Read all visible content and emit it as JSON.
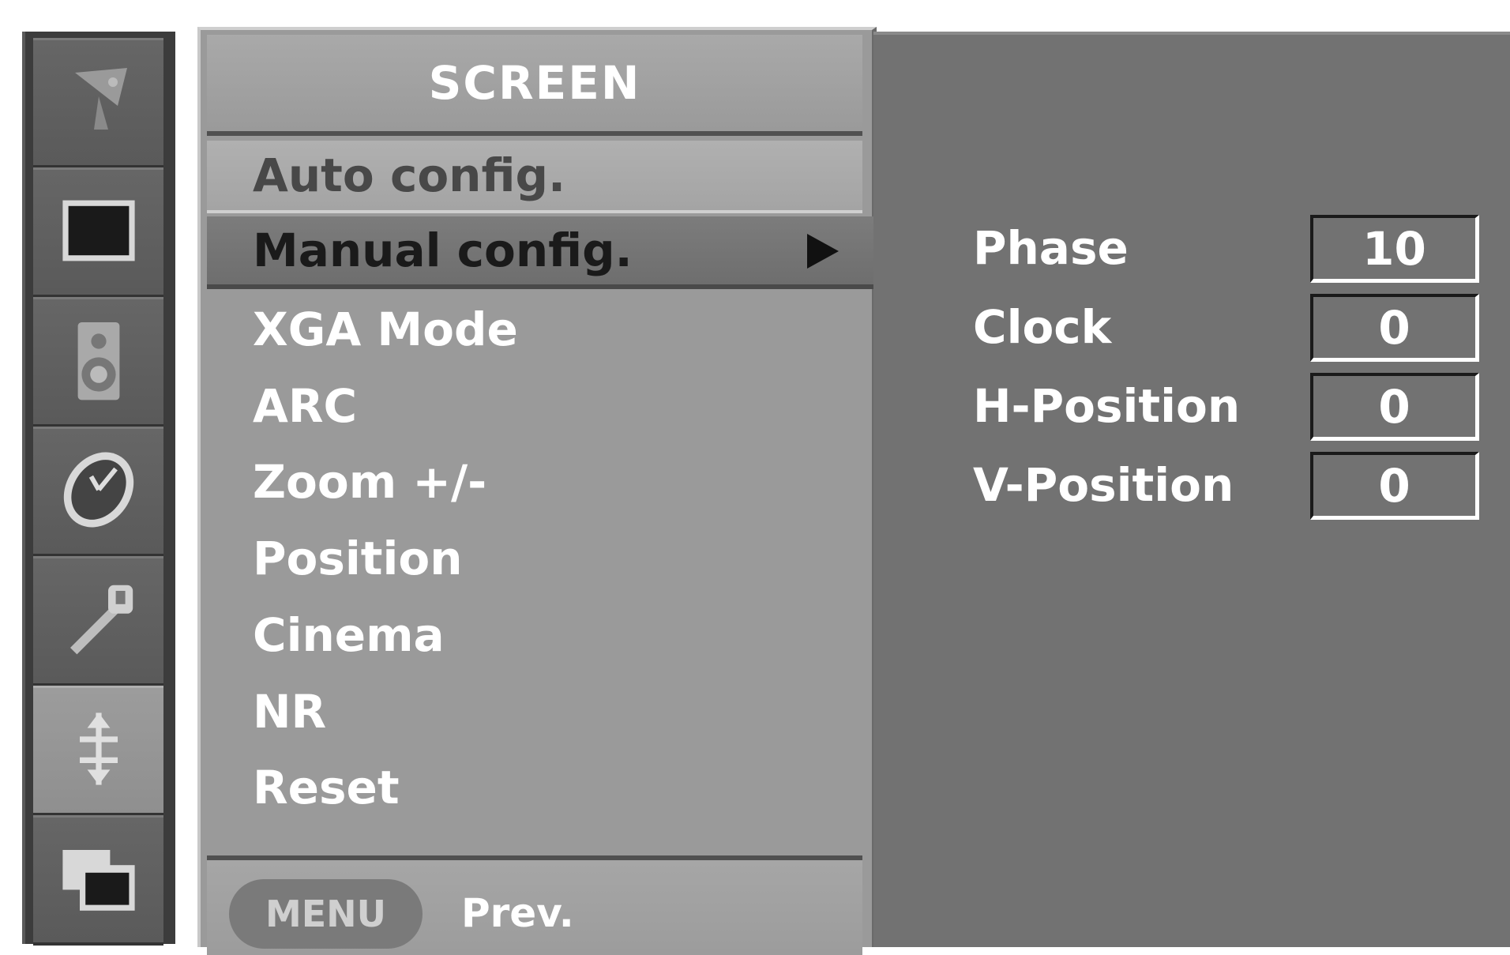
{
  "menu": {
    "title": "SCREEN",
    "items": [
      {
        "label": "Auto config."
      },
      {
        "label": "Manual config."
      },
      {
        "label": "XGA Mode"
      },
      {
        "label": "ARC"
      },
      {
        "label": "Zoom +/-"
      },
      {
        "label": "Position"
      },
      {
        "label": "Cinema"
      },
      {
        "label": "NR"
      },
      {
        "label": "Reset"
      }
    ],
    "footer": {
      "button_label": "MENU",
      "prev_label": "Prev."
    }
  },
  "submenu": {
    "items": [
      {
        "label": "Phase",
        "value": "10"
      },
      {
        "label": "Clock",
        "value": "0"
      },
      {
        "label": "H-Position",
        "value": "0"
      },
      {
        "label": "V-Position",
        "value": "0"
      }
    ]
  },
  "sidebar": {
    "icons": [
      "satellite-dish-icon",
      "screen-picture-icon",
      "speaker-audio-icon",
      "clock-time-icon",
      "wrench-option-icon",
      "screen-adjust-icon",
      "pip-windows-icon"
    ],
    "active_index": 5
  }
}
